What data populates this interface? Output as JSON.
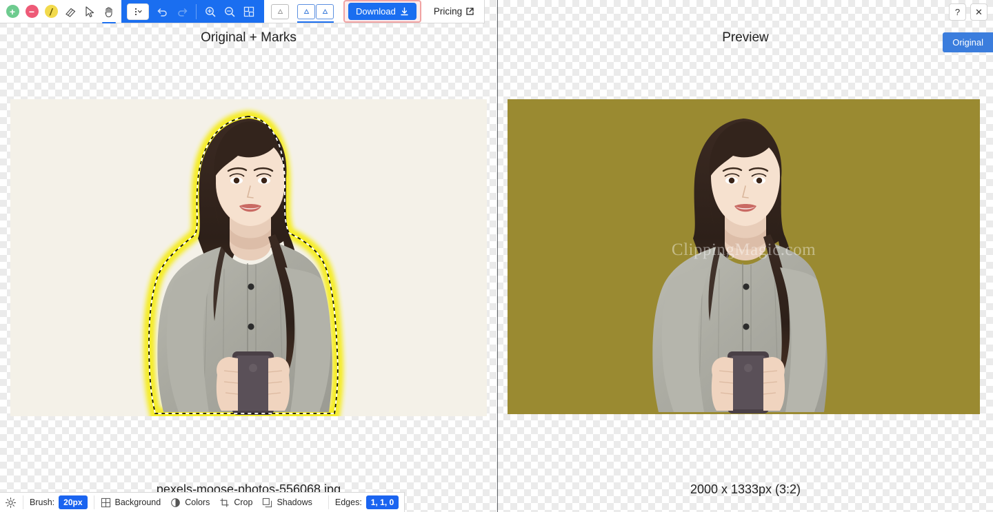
{
  "toolbar": {
    "tools": [
      {
        "name": "add-foreground-tool",
        "glyph": "+",
        "title": "Add foreground"
      },
      {
        "name": "remove-background-tool",
        "glyph": "−",
        "title": "Remove background"
      },
      {
        "name": "hairline-tool",
        "glyph": "/",
        "title": "Hair / scalpel"
      },
      {
        "name": "eraser-tool",
        "glyph": "",
        "title": "Eraser"
      },
      {
        "name": "pointer-tool",
        "glyph": "",
        "title": "Pointer"
      },
      {
        "name": "hand-tool",
        "glyph": "",
        "title": "Pan"
      }
    ],
    "brush_dropdown_label": "",
    "undo_label": "Undo",
    "redo_label": "Redo",
    "zoom_in_label": "Zoom in",
    "zoom_out_label": "Zoom out",
    "fit_label": "Fit to screen",
    "single_view_label": "Single view",
    "split_view_label": "Split view",
    "download_label": "Download",
    "pricing_label": "Pricing"
  },
  "window": {
    "help_label": "?",
    "close_label": "✕",
    "original_button_label": "Original"
  },
  "left_pane": {
    "title": "Original + Marks",
    "caption": "pexels-moose-photos-556068.jpg"
  },
  "right_pane": {
    "title": "Preview",
    "caption": "2000 x 1333px (3:2)",
    "watermark": "ClippingMagic.com",
    "background_color": "#9a8a31"
  },
  "bottom_bar": {
    "settings_label": "Settings",
    "brush_label": "Brush:",
    "brush_value": "20px",
    "background_label": "Background",
    "colors_label": "Colors",
    "crop_label": "Crop",
    "shadows_label": "Shadows",
    "edges_label": "Edges:",
    "edges_value": "1, 1, 0"
  },
  "colors": {
    "accent": "#1a6ef0",
    "badge": "#1a64f0",
    "highlight_border": "#f0a3a3",
    "marker_yellow": "#f5ec1a",
    "original_bg": "#f4f1e8",
    "preview_bg": "#9a8a31"
  }
}
